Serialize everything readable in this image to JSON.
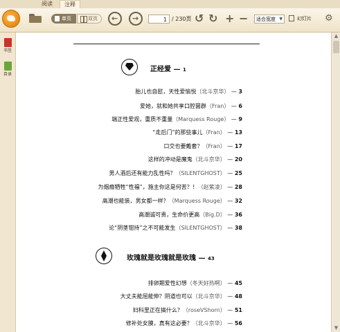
{
  "tabs": [
    {
      "label": "阅读"
    },
    {
      "label": "注释"
    }
  ],
  "toolbar": {
    "single_label": "单页",
    "double_label": "双页",
    "page_current": "1",
    "page_total": "/ 230页",
    "fit_mode": "适合宽度",
    "slideshow_label": "幻灯片",
    "icons": [
      "app-logo-icon",
      "folder-icon",
      "prev-icon",
      "next-icon",
      "rotate-left-icon",
      "rotate-right-icon",
      "zoom-in-icon",
      "zoom-out-icon",
      "gear-icon"
    ]
  },
  "rail": {
    "bookmark_label": "书签",
    "toc_label": "目录"
  },
  "doc": {
    "sections": [
      {
        "title": "正经爱",
        "page": "1",
        "icon": "diamond-icon",
        "items": [
          {
            "title": "胎儿也自慰，天性爱愉悦",
            "author": "（北斗京华）",
            "page": "3"
          },
          {
            "title": "爱她，就和她共享口腔菌群",
            "author": "（Fran）",
            "page": "6"
          },
          {
            "title": "端正性爱观，重质不重量",
            "author": "（Marquess Rouge）",
            "page": "9"
          },
          {
            "title": "“走后门”的那些事儿",
            "author": "（Fran）",
            "page": "13"
          },
          {
            "title": "口交也要戴套？",
            "author": "（Fran）",
            "page": "17"
          },
          {
            "title": "这样的冲动是魔鬼",
            "author": "（北斗京华）",
            "page": "20"
          },
          {
            "title": "男人酒后还有能力乱性吗？",
            "author": "（SILENTGHOST）",
            "page": "25"
          },
          {
            "title": "为烟瘾牺牲“性福”，施主你这是何苦？！",
            "author": "（赵紫凌）",
            "page": "28"
          },
          {
            "title": "高潮也能装，男女都一样？",
            "author": "（Marquess Rouge）",
            "page": "32"
          },
          {
            "title": "高潮诚可贵，生命价更高",
            "author": "（Big.D）",
            "page": "36"
          },
          {
            "title": "论“阴茎钳持”之不可能发生",
            "author": "（SILENTGHOST）",
            "page": "38"
          }
        ]
      },
      {
        "title": "玫瑰就是玫瑰就是玫瑰",
        "page": "43",
        "icon": "leaf-icon",
        "items": [
          {
            "title": "排卵期爱性幻想",
            "author": "（冬天好热啊）",
            "page": "45"
          },
          {
            "title": "大丈夫能屈能伸？阴道也可以",
            "author": "（北斗京华）",
            "page": "48"
          },
          {
            "title": "妇科里正在搞什么？",
            "author": "（roseVShorn）",
            "page": "51"
          },
          {
            "title": "修补处女膜，真有这必要？",
            "author": "（北斗京华）",
            "page": "56"
          }
        ]
      }
    ]
  }
}
